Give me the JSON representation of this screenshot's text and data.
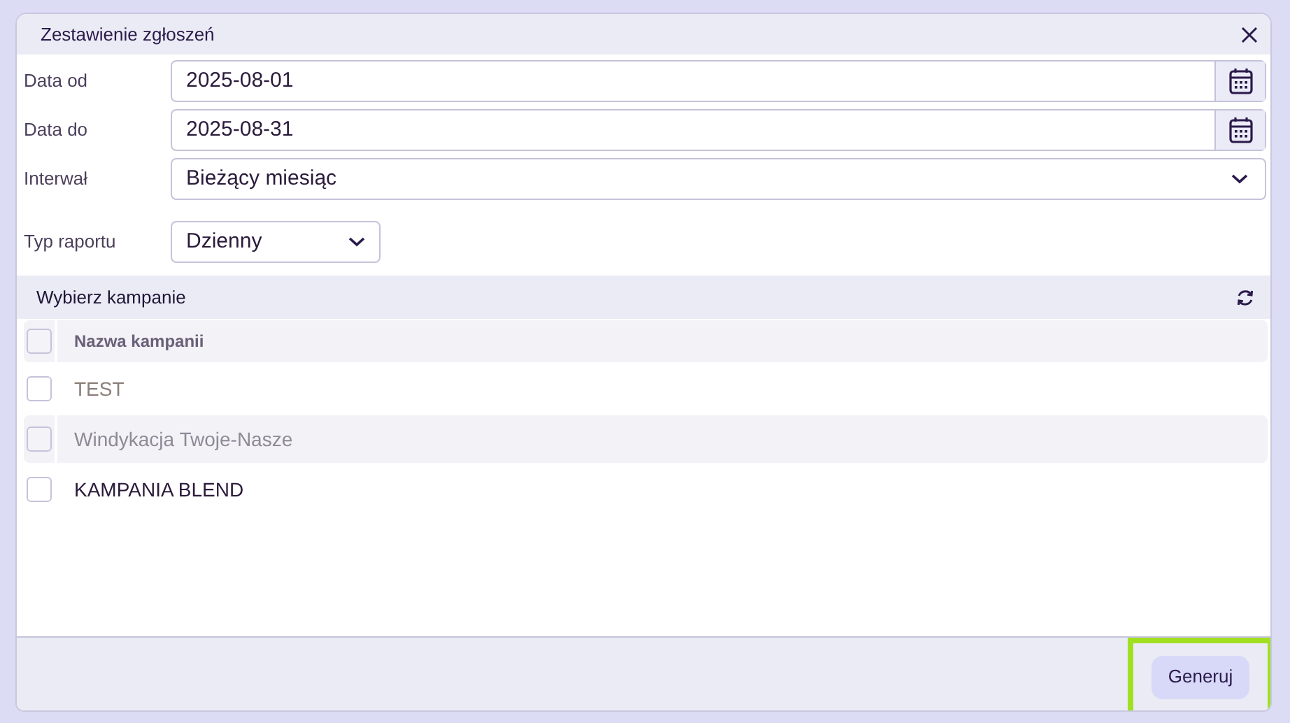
{
  "dialog": {
    "title": "Zestawienie zgłoszeń"
  },
  "fields": [
    {
      "kind": "date",
      "label": "Data od",
      "value": "2025-08-01"
    },
    {
      "kind": "date",
      "label": "Data do",
      "value": "2025-08-31"
    },
    {
      "kind": "select",
      "label": "Interwał",
      "value": "Bieżący miesiąc"
    }
  ],
  "report_type": {
    "label": "Typ raportu",
    "value": "Dzienny"
  },
  "campaigns": {
    "title": "Wybierz kampanie",
    "header": {
      "label": "Nazwa kampanii",
      "checked": false
    },
    "rows": [
      {
        "name": "TEST",
        "checked": false,
        "color": "#8c7f78"
      },
      {
        "name": "Windykacja Twoje-Nasze",
        "checked": false,
        "color": "#8f8a96"
      },
      {
        "name": "KAMPANIA BLEND",
        "checked": false,
        "color": "#2a1a3a"
      }
    ]
  },
  "footer": {
    "button": "Generuj",
    "highlighted": true
  }
}
